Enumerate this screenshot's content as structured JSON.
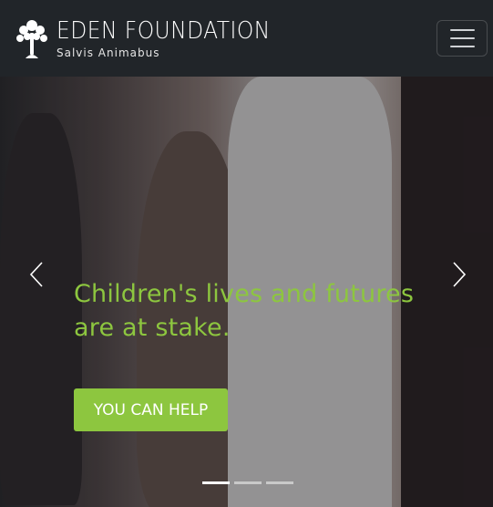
{
  "navbar": {
    "brand_name": "EDEN FOUNDATION",
    "brand_tagline": "Salvis Animabus",
    "toggle_icon": "hamburger-menu-icon"
  },
  "hero": {
    "headline": "Children's lives and futures are at stake.",
    "cta_label": "YOU CAN HELP",
    "prev_icon": "chevron-left-icon",
    "next_icon": "chevron-right-icon",
    "slides_total": 3,
    "active_slide": 1
  },
  "colors": {
    "navbar_bg": "#212529",
    "accent": "#8dc63f",
    "text_light": "#ffffff"
  }
}
